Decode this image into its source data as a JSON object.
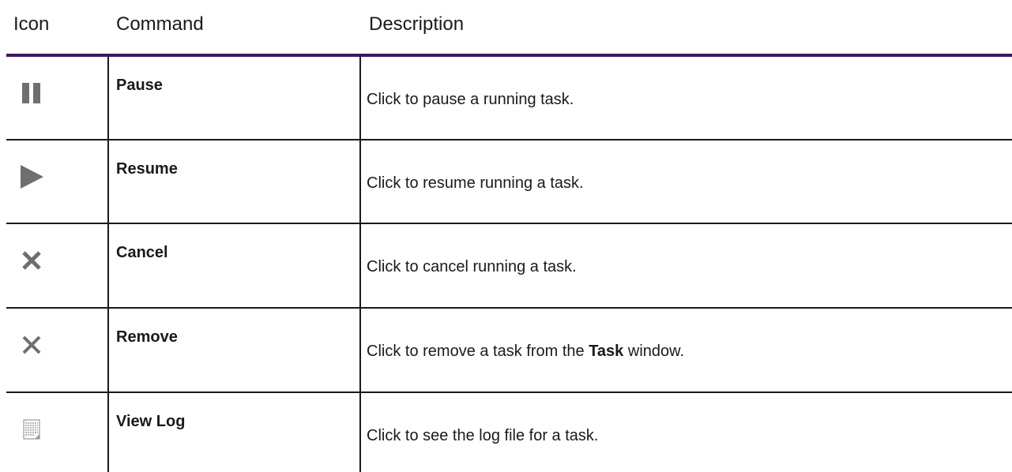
{
  "header": {
    "icon": "Icon",
    "command": "Command",
    "description": "Description"
  },
  "rows": [
    {
      "icon": "pause-icon",
      "command": "Pause",
      "description": "Click to pause a running task."
    },
    {
      "icon": "play-icon",
      "command": "Resume",
      "description": "Click to resume running a task."
    },
    {
      "icon": "x-icon",
      "command": "Cancel",
      "description": "Click to cancel running a task."
    },
    {
      "icon": "x-icon",
      "command": "Remove",
      "description_pre": "Click to remove a task from the ",
      "description_bold": "Task",
      "description_post": " window."
    },
    {
      "icon": "log-file-icon",
      "command": "View Log",
      "description": "Click to see the log file for a task."
    }
  ],
  "colors": {
    "header_rule": "#3b1470",
    "icon_gray": "#6f6f6f",
    "text": "#1a1a1a"
  }
}
